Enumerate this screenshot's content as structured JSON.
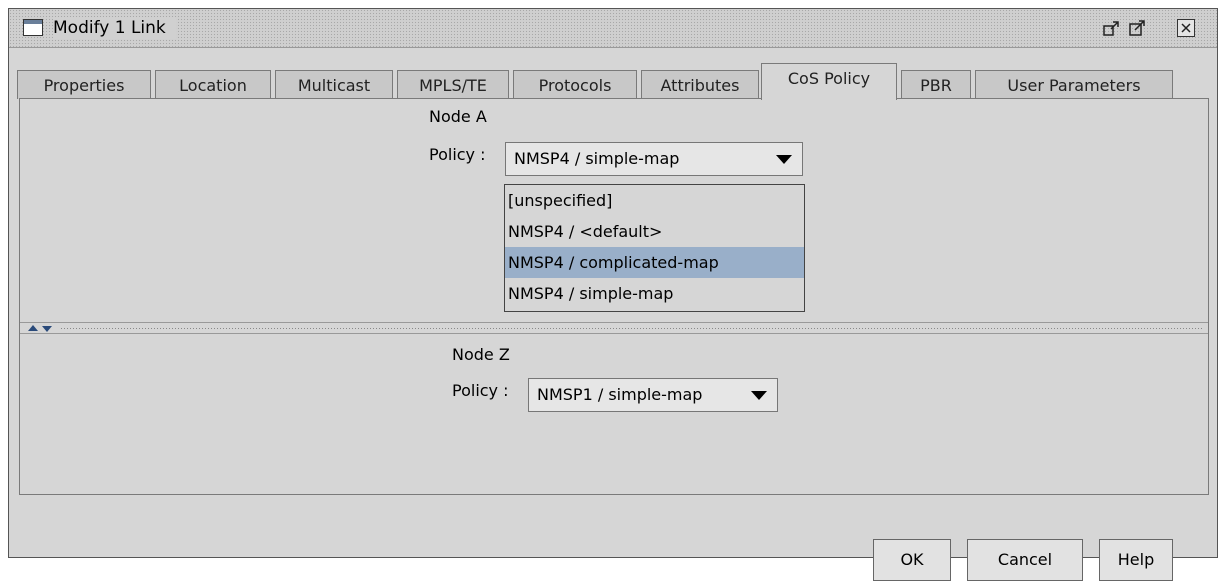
{
  "window": {
    "title": "Modify 1 Link",
    "controls": [
      "restore-icon",
      "maximize-icon",
      "close-icon"
    ]
  },
  "tabs": [
    {
      "label": "Properties",
      "active": false
    },
    {
      "label": "Location",
      "active": false
    },
    {
      "label": "Multicast",
      "active": false
    },
    {
      "label": "MPLS/TE",
      "active": false
    },
    {
      "label": "Protocols",
      "active": false
    },
    {
      "label": "Attributes",
      "active": false
    },
    {
      "label": "CoS Policy",
      "active": true
    },
    {
      "label": "PBR",
      "active": false
    },
    {
      "label": "User Parameters",
      "active": false
    }
  ],
  "node_a": {
    "title": "Node A",
    "policy_label": "Policy :",
    "selected": "NMSP4 / simple-map",
    "options": [
      "[unspecified]",
      "NMSP4 / <default>",
      "NMSP4 / complicated-map",
      "NMSP4 / simple-map"
    ],
    "highlighted_option": "NMSP4 / complicated-map"
  },
  "node_z": {
    "title": "Node Z",
    "policy_label": "Policy :",
    "selected": "NMSP1 / simple-map"
  },
  "buttons": {
    "ok": "OK",
    "cancel": "Cancel",
    "help": "Help"
  }
}
